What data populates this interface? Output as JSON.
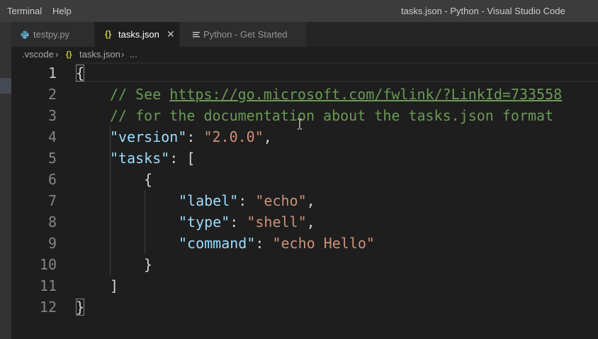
{
  "menu": {
    "terminal": "Terminal",
    "help": "Help"
  },
  "window_title": "tasks.json - Python - Visual Studio Code",
  "tabs": [
    {
      "label": "testpy.py",
      "icon": "python-icon",
      "active": false
    },
    {
      "label": "tasks.json",
      "icon": "json-braces-icon",
      "active": true,
      "icon_glyph": "{}"
    },
    {
      "label": "Python - Get Started",
      "icon": "welcome-page-icon",
      "active": false
    }
  ],
  "breadcrumb": {
    "folder": ".vscode",
    "file_icon": "{}",
    "file": "tasks.json",
    "more": "..."
  },
  "editor": {
    "line_numbers": [
      "1",
      "2",
      "3",
      "4",
      "5",
      "6",
      "7",
      "8",
      "9",
      "10",
      "11",
      "12"
    ],
    "active_line": "1",
    "lines": {
      "l1_brace": "{",
      "l2_comment_prefix": "// See ",
      "l2_url": "https://go.microsoft.com/fwlink/?LinkId=733558",
      "l3_comment": "// for the documentation about the tasks.json format",
      "l4_key": "\"version\"",
      "l4_sep": ": ",
      "l4_value": "\"2.0.0\"",
      "l4_end": ",",
      "l5_key": "\"tasks\"",
      "l5_sep": ": ",
      "l5_bracket": "[",
      "l6_brace": "{",
      "l7_key": "\"label\"",
      "l7_sep": ": ",
      "l7_value": "\"echo\"",
      "l7_end": ",",
      "l8_key": "\"type\"",
      "l8_sep": ": ",
      "l8_value": "\"shell\"",
      "l8_end": ",",
      "l9_key": "\"command\"",
      "l9_sep": ": ",
      "l9_value": "\"echo Hello\"",
      "l10_brace": "}",
      "l11_bracket": "]",
      "l12_brace": "}"
    }
  },
  "colors": {
    "background": "#1e1e1e",
    "titlebar": "#3c3c3c",
    "comment": "#6a9955",
    "json_key": "#9cdcfe",
    "json_string": "#ce9178",
    "json_icon": "#cbcb41",
    "python_icon": "#519aba"
  }
}
